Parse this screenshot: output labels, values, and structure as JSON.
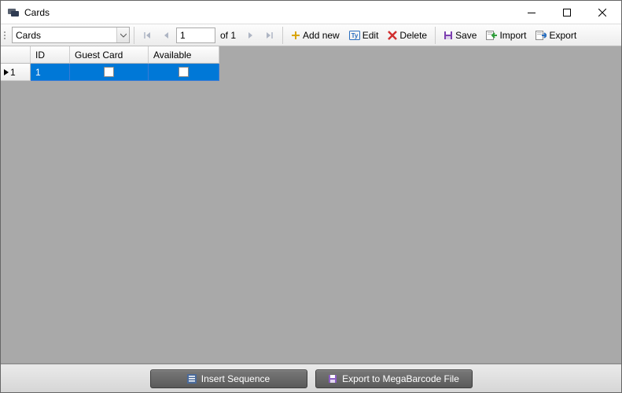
{
  "window": {
    "title": "Cards"
  },
  "toolbar": {
    "combo_value": "Cards",
    "page_value": "1",
    "of_text": "of 1",
    "add_label": "Add new",
    "edit_label": "Edit",
    "delete_label": "Delete",
    "save_label": "Save",
    "import_label": "Import",
    "export_label": "Export"
  },
  "grid": {
    "columns": [
      "",
      "ID",
      "Guest Card",
      "Available"
    ],
    "rows": [
      {
        "rownum": "1",
        "id": "1",
        "guest_card": false,
        "available": false
      }
    ]
  },
  "bottom": {
    "insert_label": "Insert Sequence",
    "export_label": "Export to MegaBarcode File"
  },
  "colors": {
    "selected_row": "#0078d7",
    "plus": "#d9a400",
    "delete_x": "#d12f2f",
    "save": "#7d3fb0",
    "import_arrow": "#2e9e3a",
    "export_arrow": "#2b6fbf"
  }
}
